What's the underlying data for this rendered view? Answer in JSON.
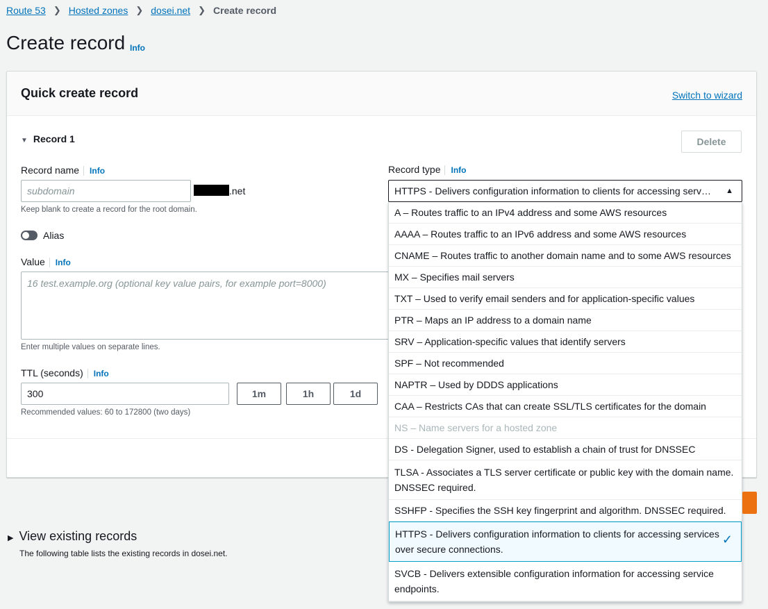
{
  "breadcrumb": {
    "items": [
      "Route 53",
      "Hosted zones",
      "dosei.net"
    ],
    "current": "Create record"
  },
  "page": {
    "title": "Create record",
    "info": "Info"
  },
  "panel": {
    "title": "Quick create record",
    "switch_link": "Switch to wizard",
    "record_header": "Record 1",
    "delete_label": "Delete"
  },
  "record_name": {
    "label": "Record name",
    "info": "Info",
    "placeholder": "subdomain",
    "domain_suffix": ".net",
    "hint": "Keep blank to create a record for the root domain."
  },
  "alias": {
    "label": "Alias"
  },
  "value": {
    "label": "Value",
    "info": "Info",
    "placeholder": "16 test.example.org (optional key value pairs, for example port=8000)",
    "hint": "Enter multiple values on separate lines."
  },
  "ttl": {
    "label": "TTL (seconds)",
    "info": "Info",
    "value": "300",
    "buttons": [
      "1m",
      "1h",
      "1d"
    ],
    "hint": "Recommended values: 60 to 172800 (two days)"
  },
  "record_type": {
    "label": "Record type",
    "info": "Info",
    "selected": "HTTPS - Delivers configuration information to clients for accessing serv…",
    "options": [
      "A – Routes traffic to an IPv4 address and some AWS resources",
      "AAAA – Routes traffic to an IPv6 address and some AWS resources",
      "CNAME – Routes traffic to another domain name and to some AWS resources",
      "MX – Specifies mail servers",
      "TXT – Used to verify email senders and for application-specific values",
      "PTR – Maps an IP address to a domain name",
      "SRV – Application-specific values that identify servers",
      "SPF – Not recommended",
      "NAPTR – Used by DDDS applications",
      "CAA – Restricts CAs that can create SSL/TLS certificates for the domain",
      "NS – Name servers for a hosted zone",
      "DS - Delegation Signer, used to establish a chain of trust for DNSSEC",
      "TLSA - Associates a TLS server certificate or public key with the domain name. DNSSEC required.",
      "SSHFP - Specifies the SSH key fingerprint and algorithm. DNSSEC required.",
      "HTTPS - Delivers configuration information to clients for accessing services over secure connections.",
      "SVCB - Delivers extensible configuration information for accessing service endpoints."
    ]
  },
  "existing": {
    "title": "View existing records",
    "desc": "The following table lists the existing records in dosei.net."
  },
  "colors": {
    "link": "#0073bb",
    "primary": "#ec7211",
    "selected_border": "#00a1c9"
  }
}
